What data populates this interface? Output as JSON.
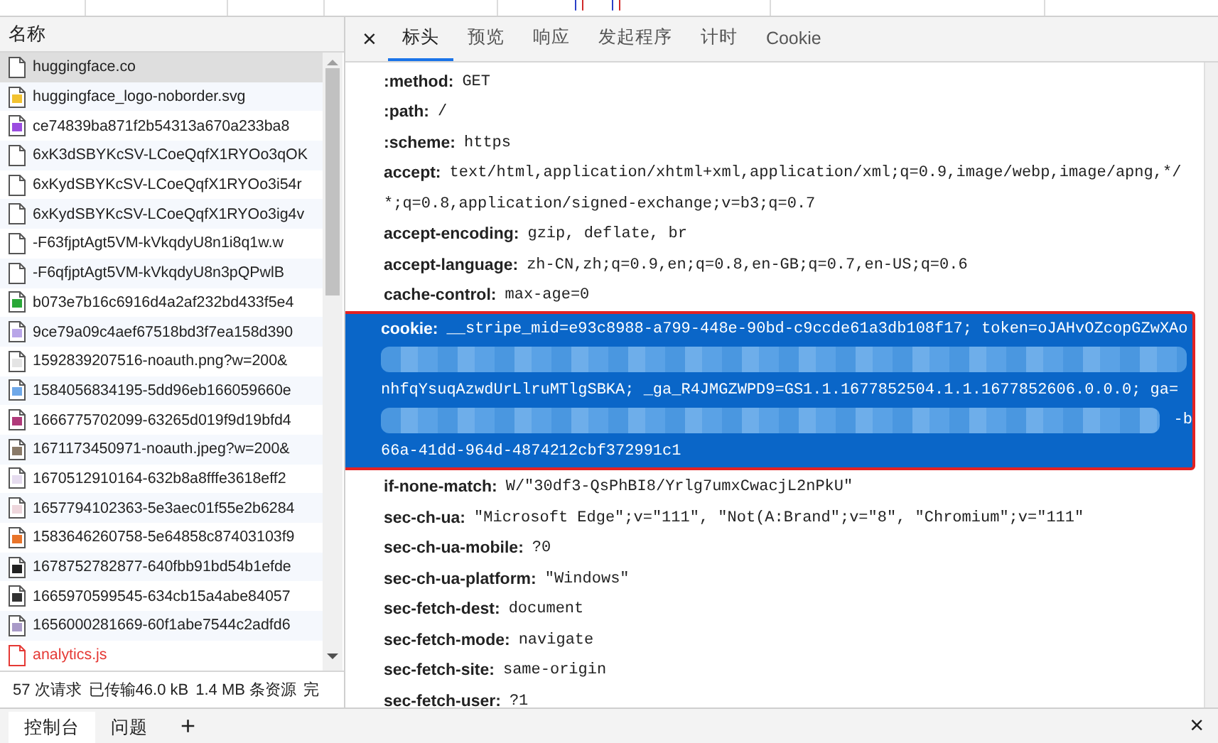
{
  "requests": {
    "column_header": "名称",
    "items": [
      {
        "name": "huggingface.co",
        "kind": "document",
        "selected": true,
        "failed": false
      },
      {
        "name": "huggingface_logo-noborder.svg",
        "kind": "image",
        "color": "#f2c230",
        "selected": false,
        "failed": false
      },
      {
        "name": "ce74839ba871f2b54313a670a233ba8",
        "kind": "image",
        "color": "#9b4de0",
        "selected": false,
        "failed": false
      },
      {
        "name": "6xK3dSBYKcSV-LCoeQqfX1RYOo3qOK",
        "kind": "document",
        "selected": false,
        "failed": false
      },
      {
        "name": "6xKydSBYKcSV-LCoeQqfX1RYOo3i54r",
        "kind": "document",
        "selected": false,
        "failed": false
      },
      {
        "name": "6xKydSBYKcSV-LCoeQqfX1RYOo3ig4v",
        "kind": "document",
        "selected": false,
        "failed": false
      },
      {
        "name": "-F63fjptAgt5VM-kVkqdyU8n1i8q1w.w",
        "kind": "document",
        "selected": false,
        "failed": false
      },
      {
        "name": "-F6qfjptAgt5VM-kVkqdyU8n3pQPwlB",
        "kind": "document",
        "selected": false,
        "failed": false
      },
      {
        "name": "b073e7b16c6916d4a2af232bd433f5e4",
        "kind": "image",
        "color": "#2aa838",
        "selected": false,
        "failed": false
      },
      {
        "name": "9ce79a09c4aef67518bd3f7ea158d390",
        "kind": "image",
        "color": "#b9a6e8",
        "selected": false,
        "failed": false
      },
      {
        "name": "1592839207516-noauth.png?w=200&",
        "kind": "image",
        "color": "#e4e4e4",
        "selected": false,
        "failed": false
      },
      {
        "name": "1584056834195-5dd96eb166059660e",
        "kind": "image",
        "color": "#6fa8e8",
        "selected": false,
        "failed": false
      },
      {
        "name": "1666775702099-63265d019f9d19bfd4",
        "kind": "image",
        "color": "#b03a7a",
        "selected": false,
        "failed": false
      },
      {
        "name": "1671173450971-noauth.jpeg?w=200&",
        "kind": "image",
        "color": "#8a7a68",
        "selected": false,
        "failed": false
      },
      {
        "name": "1670512910164-632b8a8fffe3618eff2",
        "kind": "image",
        "color": "#e6dcef",
        "selected": false,
        "failed": false
      },
      {
        "name": "1657794102363-5e3aec01f55e2b6284",
        "kind": "image",
        "color": "#eed6dc",
        "selected": false,
        "failed": false
      },
      {
        "name": "1583646260758-5e64858c87403103f9",
        "kind": "image",
        "color": "#e8742a",
        "selected": false,
        "failed": false
      },
      {
        "name": "1678752782877-640fbb91bd54b1efde",
        "kind": "image",
        "color": "#222222",
        "selected": false,
        "failed": false
      },
      {
        "name": "1665970599545-634cb15a4abe84057",
        "kind": "image",
        "color": "#333333",
        "selected": false,
        "failed": false
      },
      {
        "name": "1656000281669-60f1abe7544c2adfd6",
        "kind": "image",
        "color": "#a99ac8",
        "selected": false,
        "failed": false
      },
      {
        "name": "analytics.js",
        "kind": "document",
        "selected": false,
        "failed": true
      }
    ]
  },
  "status_bar": {
    "requests": "57 次请求",
    "transferred": "已传输46.0 kB",
    "resources": "1.4 MB 条资源",
    "finish": "完"
  },
  "detail_tabs": [
    {
      "label": "标头",
      "selected": true
    },
    {
      "label": "预览",
      "selected": false
    },
    {
      "label": "响应",
      "selected": false
    },
    {
      "label": "发起程序",
      "selected": false
    },
    {
      "label": "计时",
      "selected": false
    },
    {
      "label": "Cookie",
      "selected": false
    }
  ],
  "close_icon": "×",
  "headers": [
    {
      "name": ":method:",
      "lines": [
        "GET"
      ]
    },
    {
      "name": ":path:",
      "lines": [
        "/"
      ]
    },
    {
      "name": ":scheme:",
      "lines": [
        "https"
      ]
    },
    {
      "name": "accept:",
      "lines": [
        "text/html,application/xhtml+xml,application/xml;q=0.9,image/webp,image/apng,*/",
        "*;q=0.8,application/signed-exchange;v=b3;q=0.7"
      ]
    },
    {
      "name": "accept-encoding:",
      "lines": [
        "gzip, deflate, br"
      ]
    },
    {
      "name": "accept-language:",
      "lines": [
        "zh-CN,zh;q=0.9,en;q=0.8,en-GB;q=0.7,en-US;q=0.6"
      ]
    },
    {
      "name": "cache-control:",
      "lines": [
        "max-age=0"
      ]
    },
    {
      "name": "cookie:",
      "highlighted": true,
      "cookie_lines": [
        {
          "kind": "text",
          "text": "__stripe_mid=e93c8988-a799-448e-90bd-c9ccde61a3db108f17; token=oJAHvOZcopGZwXAo"
        },
        {
          "kind": "redacted"
        },
        {
          "kind": "text",
          "text": "nhfqYsuqAzwdUrLlruMTlgSBKA; _ga_R4JMGZWPD9=GS1.1.1677852504.1.1.1677852606.0.0.0;  ga="
        },
        {
          "kind": "redacted",
          "tail": "-b"
        },
        {
          "kind": "text",
          "text": "66a-41dd-964d-4874212cbf372991c1"
        }
      ]
    },
    {
      "name": "if-none-match:",
      "lines": [
        "W/\"30df3-QsPhBI8/Yrlg7umxCwacjL2nPkU\""
      ]
    },
    {
      "name": "sec-ch-ua:",
      "lines": [
        "\"Microsoft Edge\";v=\"111\", \"Not(A:Brand\";v=\"8\", \"Chromium\";v=\"111\""
      ]
    },
    {
      "name": "sec-ch-ua-mobile:",
      "lines": [
        "?0"
      ]
    },
    {
      "name": "sec-ch-ua-platform:",
      "lines": [
        "\"Windows\""
      ]
    },
    {
      "name": "sec-fetch-dest:",
      "lines": [
        "document"
      ]
    },
    {
      "name": "sec-fetch-mode:",
      "lines": [
        "navigate"
      ]
    },
    {
      "name": "sec-fetch-site:",
      "lines": [
        "same-origin"
      ]
    },
    {
      "name": "sec-fetch-user:",
      "lines": [
        "?1"
      ]
    }
  ],
  "drawer_tabs": [
    {
      "label": "控制台",
      "selected": true
    },
    {
      "label": "问题",
      "selected": false
    }
  ],
  "drawer_add": "+",
  "drawer_close": "×"
}
